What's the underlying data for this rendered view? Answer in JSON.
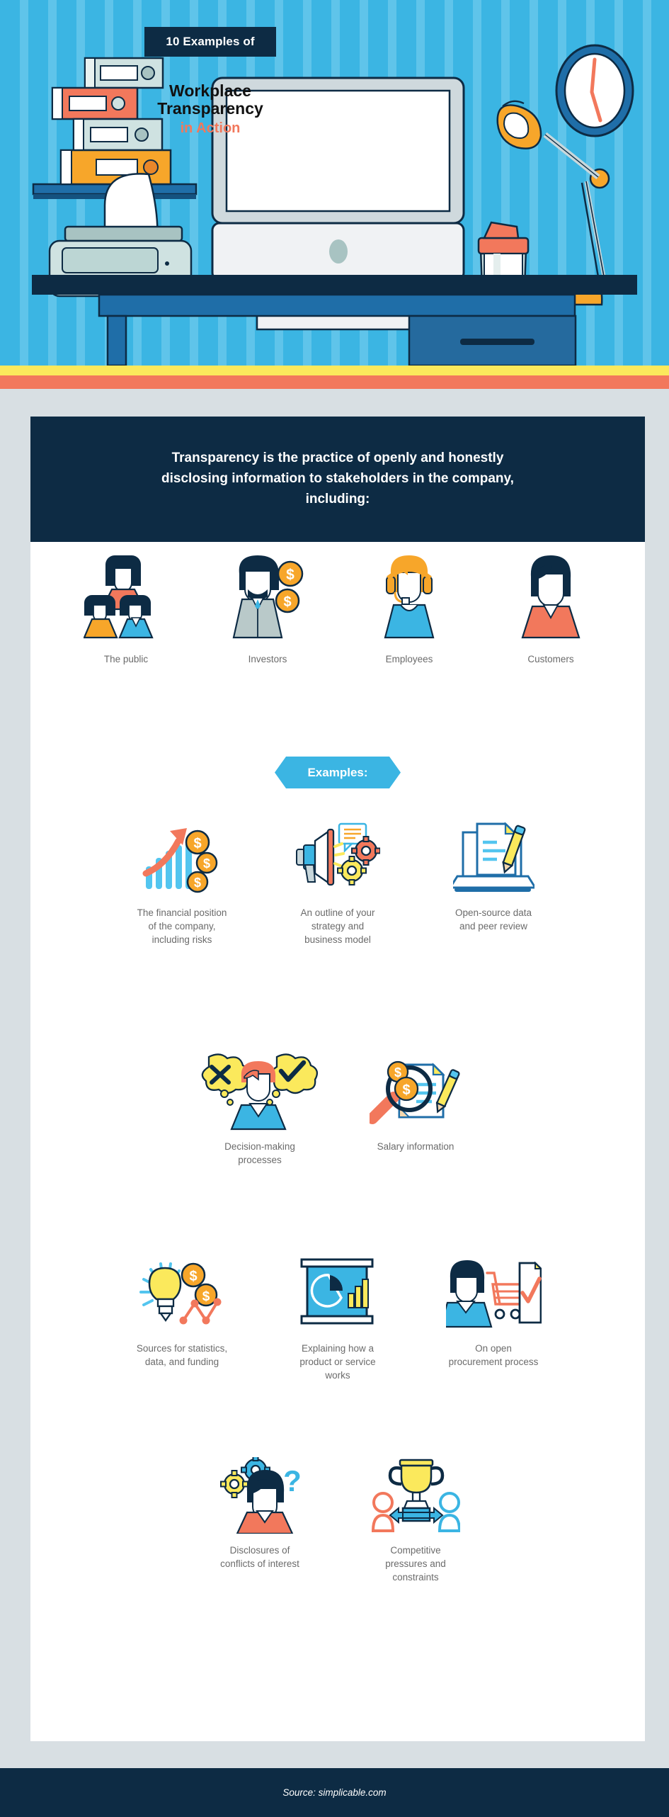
{
  "hero": {
    "title_banner": "10 Examples of",
    "screen_line1": "Workplace",
    "screen_line2": "Transparency",
    "screen_line3": "in Action",
    "colors": {
      "stripe_dark": "#3bb5e3",
      "stripe_light": "#5fc4ea",
      "navy": "#0d2b44",
      "accent_orange": "#f2785c",
      "accent_yellow": "#fbe95c",
      "page_bg": "#d8dfe3"
    }
  },
  "intro": {
    "text": "Transparency is the practice of openly and honestly disclosing information to stakeholders in the company, including:"
  },
  "stakeholders": [
    {
      "label": "The public",
      "icon": "family-group-icon"
    },
    {
      "label": "Investors",
      "icon": "investor-with-coins-icon"
    },
    {
      "label": "Employees",
      "icon": "employee-headset-icon"
    },
    {
      "label": "Customers",
      "icon": "customer-person-icon"
    }
  ],
  "examples_banner": {
    "label": "Examples:"
  },
  "examples": [
    {
      "label": "The financial position of the company, including risks",
      "icon": "growth-chart-coins-icon"
    },
    {
      "label": "An outline of your strategy and business model",
      "icon": "megaphone-gears-icon"
    },
    {
      "label": "Open-source data and peer review",
      "icon": "laptop-document-pencil-icon"
    },
    {
      "label": "Decision-making processes",
      "icon": "thought-bubbles-person-icon"
    },
    {
      "label": "Salary information",
      "icon": "magnifier-payslip-icon"
    },
    {
      "label": "Sources for statistics, data, and funding",
      "icon": "lightbulb-coins-graph-icon"
    },
    {
      "label": "Explaining how a product or service works",
      "icon": "presentation-chart-icon"
    },
    {
      "label": "On open procurement process",
      "icon": "shopper-cart-checklist-icon"
    },
    {
      "label": "Disclosures of conflicts of interest",
      "icon": "person-gears-question-icon"
    },
    {
      "label": "Competitive pressures and constraints",
      "icon": "trophy-competitors-icon"
    }
  ],
  "footer": {
    "source": "Source: simplicable.com"
  }
}
